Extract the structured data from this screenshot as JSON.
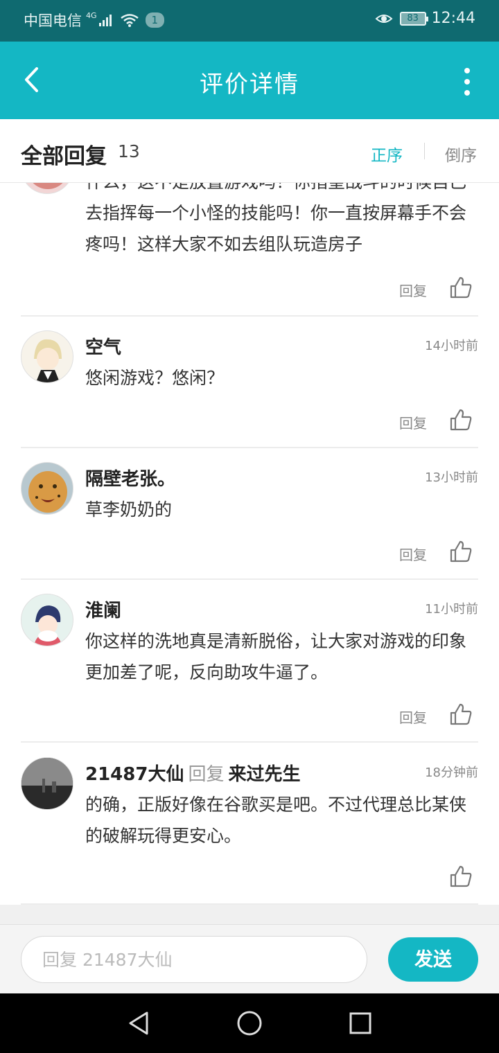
{
  "status_bar": {
    "carrier": "中国电信",
    "network": "4G",
    "badge": "1",
    "battery": "83",
    "time": "12:44"
  },
  "app_bar": {
    "title": "评价详情",
    "icons": [
      "back-arrow-icon",
      "more-vertical-icon"
    ]
  },
  "header": {
    "title": "全部回复",
    "count": "13",
    "sort_asc": "正序",
    "sort_desc": "倒序"
  },
  "comments": [
    {
      "name": "",
      "time": "",
      "text": "什么，这不是放置游戏吗！你指望战斗的时候自己去指挥每一个小怪的技能吗！你一直按屏幕手不会疼吗！这样大家不如去组队玩造房子",
      "reply_label": "回复"
    },
    {
      "name": "空气",
      "time": "14小时前",
      "text": "悠闲游戏？悠闲？",
      "reply_label": "回复"
    },
    {
      "name": "隔壁老张。",
      "time": "13小时前",
      "text": "草李奶奶的",
      "reply_label": "回复"
    },
    {
      "name": "淮阑",
      "time": "11小时前",
      "text": "你这样的洗地真是清新脱俗，让大家对游戏的印象更加差了呢，反向助攻牛逼了。",
      "reply_label": "回复"
    },
    {
      "name": "21487大仙",
      "reply_word": "回复",
      "reply_to": "来过先生",
      "time": "18分钟前",
      "text": "的确，正版好像在谷歌买是吧。不过代理总比某侠的破解玩得更安心。"
    }
  ],
  "input": {
    "placeholder": "回复 21487大仙",
    "send_label": "发送"
  },
  "colors": {
    "accent": "#14b7c4",
    "status_bar": "#0f6a70"
  }
}
